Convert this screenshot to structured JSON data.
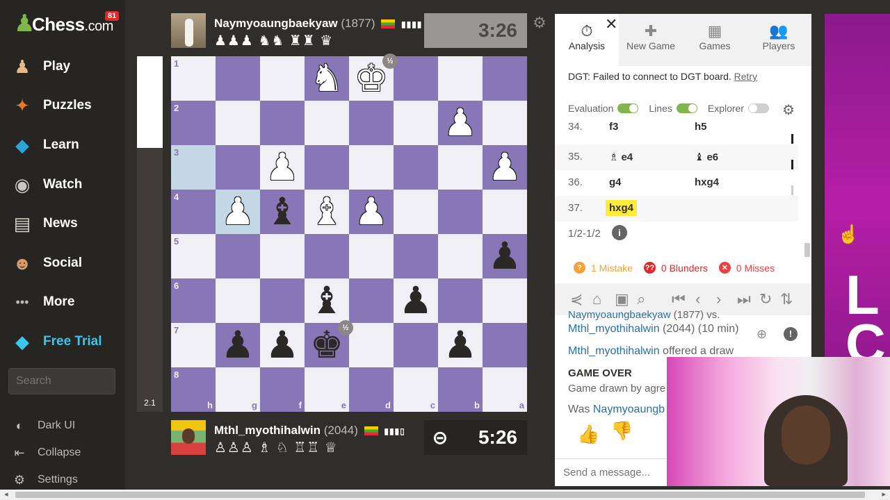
{
  "brand": {
    "logo": "Chess",
    "logo_suffix": ".com",
    "notif_count": "81"
  },
  "nav": [
    {
      "label": "Play",
      "icon": "play-icon",
      "glyph": "♟",
      "color": "#e8b78a"
    },
    {
      "label": "Puzzles",
      "icon": "puzzles-icon",
      "glyph": "✦",
      "color": "#e8762b"
    },
    {
      "label": "Learn",
      "icon": "learn-icon",
      "glyph": "◆",
      "color": "#2aa3d6"
    },
    {
      "label": "Watch",
      "icon": "watch-icon",
      "glyph": "◉",
      "color": "#c7c7c7"
    },
    {
      "label": "News",
      "icon": "news-icon",
      "glyph": "▤",
      "color": "#d9d2c8"
    },
    {
      "label": "Social",
      "icon": "social-icon",
      "glyph": "☻",
      "color": "#d99a6c"
    },
    {
      "label": "More",
      "icon": "more-icon",
      "glyph": "•••",
      "color": "#bdbbb8"
    }
  ],
  "free_trial": "Free Trial",
  "search_placeholder": "Search",
  "bottom_nav": {
    "dark_ui": "Dark UI",
    "collapse": "Collapse",
    "settings": "Settings"
  },
  "eval_score": "2.1",
  "top_player": {
    "name": "Naymyoaungbaekyaw",
    "rating": "(1877)",
    "captured": "♟♟♟ ♞♞ ♜♜ ♛",
    "clock": "3:26"
  },
  "bottom_player": {
    "name": "Mthl_myothihalwin",
    "rating": "(2044)",
    "captured": "♙♙♙ ♗ ♘ ♖♖ ♕",
    "clock": "5:26"
  },
  "board": {
    "files": [
      "h",
      "g",
      "f",
      "e",
      "d",
      "c",
      "b",
      "a"
    ],
    "ranks": [
      "1",
      "2",
      "3",
      "4",
      "5",
      "6",
      "7",
      "8"
    ],
    "highlight": [
      "h3",
      "g4"
    ],
    "pieces": [
      {
        "sq": "e1",
        "piece": "knight",
        "color": "w"
      },
      {
        "sq": "d1",
        "piece": "king",
        "color": "w",
        "badge": "½"
      },
      {
        "sq": "b2",
        "piece": "pawn",
        "color": "w"
      },
      {
        "sq": "f3",
        "piece": "pawn",
        "color": "w"
      },
      {
        "sq": "a3",
        "piece": "pawn",
        "color": "w"
      },
      {
        "sq": "g4",
        "piece": "pawn",
        "color": "w"
      },
      {
        "sq": "f4",
        "piece": "bishop",
        "color": "b"
      },
      {
        "sq": "e4",
        "piece": "bishop",
        "color": "w"
      },
      {
        "sq": "d4",
        "piece": "pawn",
        "color": "w"
      },
      {
        "sq": "a5",
        "piece": "pawn",
        "color": "b"
      },
      {
        "sq": "e6",
        "piece": "bishop",
        "color": "b"
      },
      {
        "sq": "c6",
        "piece": "pawn",
        "color": "b"
      },
      {
        "sq": "g7",
        "piece": "pawn",
        "color": "b"
      },
      {
        "sq": "f7",
        "piece": "pawn",
        "color": "b"
      },
      {
        "sq": "e7",
        "piece": "king",
        "color": "b",
        "badge": "½"
      },
      {
        "sq": "b7",
        "piece": "pawn",
        "color": "b"
      }
    ]
  },
  "tabs": [
    {
      "label": "Analysis",
      "icon": "stopwatch-icon",
      "glyph": "⏱"
    },
    {
      "label": "New Game",
      "icon": "plus-icon",
      "glyph": "✚"
    },
    {
      "label": "Games",
      "icon": "board-icon",
      "glyph": "▦"
    },
    {
      "label": "Players",
      "icon": "players-icon",
      "glyph": "👥"
    }
  ],
  "dgt": {
    "message": "DGT: Failed to connect to DGT board.",
    "retry": "Retry"
  },
  "toggles": {
    "evaluation": "Evaluation",
    "lines": "Lines",
    "explorer": "Explorer"
  },
  "moves": [
    {
      "num": "34.",
      "white": "f3",
      "black": "h5",
      "white_fig": "",
      "black_fig": ""
    },
    {
      "num": "35.",
      "white": "e4",
      "black": "e6",
      "white_fig": "♗",
      "black_fig": "♝"
    },
    {
      "num": "36.",
      "white": "g4",
      "black": "hxg4",
      "white_fig": "",
      "black_fig": ""
    },
    {
      "num": "37.",
      "white": "hxg4",
      "black": "",
      "white_fig": "",
      "black_fig": ""
    }
  ],
  "result": "1/2-1/2",
  "stats": {
    "mistakes": "1 Mistake",
    "blunders": "0 Blunders",
    "misses": "0 Misses",
    "colors": {
      "mistake": "#f7a035",
      "blunder": "#e02828",
      "miss": "#ee4040"
    }
  },
  "chat": {
    "line1_player": "Naymyoaungbaekyaw",
    "line1_rest": " (1877) vs.",
    "line2_player": "Mthl_myothihalwin",
    "line2_rest": " (2044) (10 min)",
    "line3_player": "Mthl_myothihalwin",
    "line3_rest": " offered a draw",
    "game_over": "GAME OVER",
    "drawn": "Game drawn by agre",
    "was_prefix": "Was ",
    "was_player": "Naymyoaungb",
    "send_placeholder": "Send a message..."
  },
  "promo_text": "L\nC"
}
